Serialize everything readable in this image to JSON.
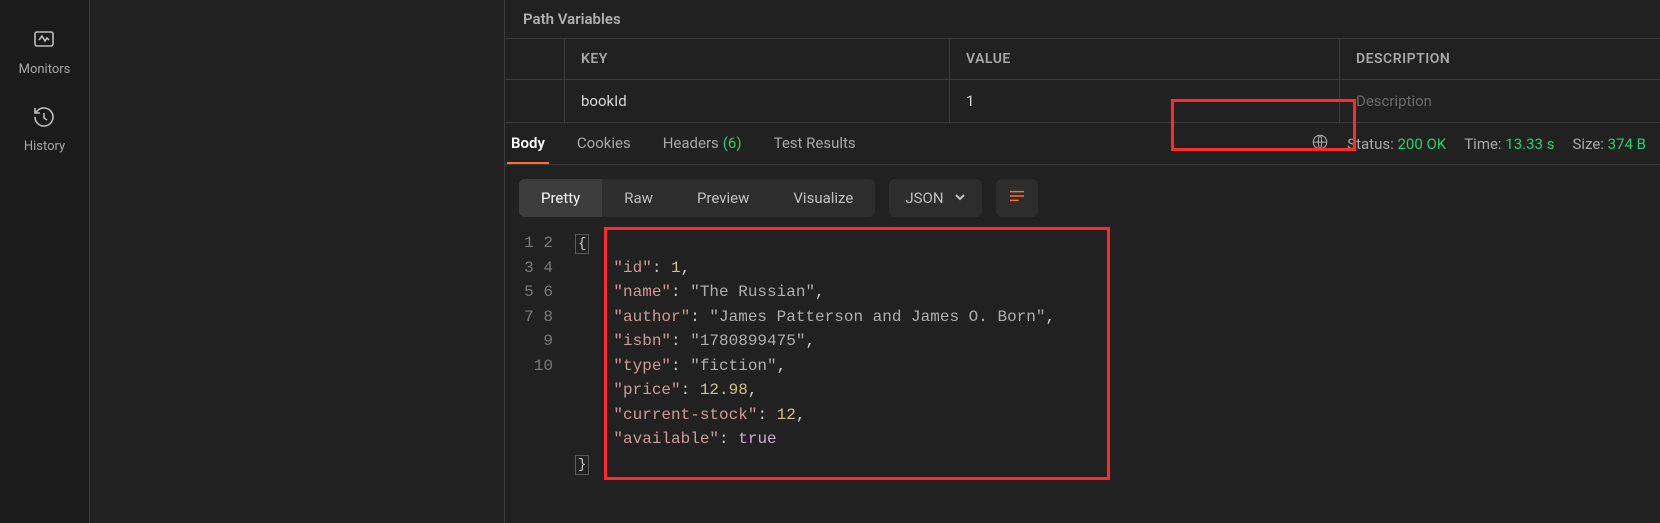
{
  "sidebar": {
    "monitors": "Monitors",
    "history": "History"
  },
  "pathVars": {
    "title": "Path Variables",
    "headers": {
      "key": "KEY",
      "value": "VALUE",
      "desc": "DESCRIPTION"
    },
    "row": {
      "key": "bookId",
      "value": "1",
      "descPlaceholder": "Description"
    }
  },
  "responseTabs": {
    "body": "Body",
    "cookies": "Cookies",
    "headers": "Headers",
    "headersCount": "(6)",
    "testResults": "Test Results"
  },
  "responseMeta": {
    "statusLabel": "Status:",
    "statusValue": "200 OK",
    "timeLabel": "Time:",
    "timeValue": "13.33 s",
    "sizeLabel": "Size:",
    "sizeValue": "374 B"
  },
  "formatBar": {
    "pretty": "Pretty",
    "raw": "Raw",
    "preview": "Preview",
    "visualize": "Visualize",
    "lang": "JSON"
  },
  "jsonBody": {
    "id_k": "\"id\"",
    "id_v": "1",
    "name_k": "\"name\"",
    "name_v": "\"The Russian\"",
    "author_k": "\"author\"",
    "author_v": "\"James Patterson and James O. Born\"",
    "isbn_k": "\"isbn\"",
    "isbn_v": "\"1780899475\"",
    "type_k": "\"type\"",
    "type_v": "\"fiction\"",
    "price_k": "\"price\"",
    "price_v": "12.98",
    "stock_k": "\"current-stock\"",
    "stock_v": "12",
    "avail_k": "\"available\"",
    "avail_v": "true"
  },
  "lineNumbers": [
    "1",
    "2",
    "3",
    "4",
    "5",
    "6",
    "7",
    "8",
    "9",
    "10"
  ]
}
